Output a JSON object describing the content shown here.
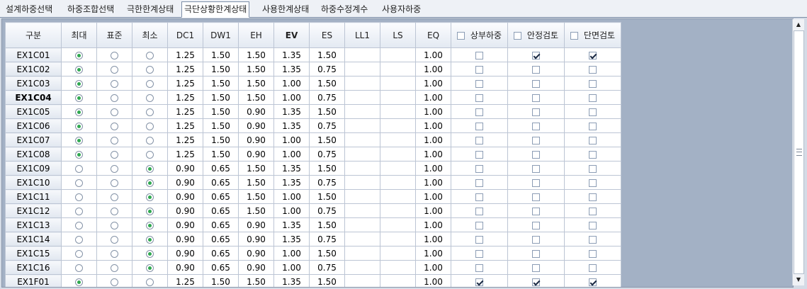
{
  "tabs": [
    "설계하중선택",
    "하중조합선택",
    "극한한계상태",
    "극단상황한계상태",
    "사용한계상태",
    "하중수정계수",
    "사용자하중"
  ],
  "active_tab": 3,
  "headers": {
    "gubun": "구분",
    "max": "최대",
    "std": "표준",
    "min": "최소",
    "dc1": "DC1",
    "dw1": "DW1",
    "eh": "EH",
    "ev": "EV",
    "es": "ES",
    "ll1": "LL1",
    "ls": "LS",
    "eq": "EQ",
    "upper": "상부하중",
    "stability": "안정검토",
    "section": "단면검토"
  },
  "rows": [
    {
      "name": "EX1C01",
      "sel": "max",
      "dc1": "1.25",
      "dw1": "1.50",
      "eh": "1.50",
      "ev": "1.35",
      "es": "1.50",
      "ll1": "",
      "ls": "",
      "eq": "1.00",
      "upper": false,
      "stability": true,
      "section": true
    },
    {
      "name": "EX1C02",
      "sel": "max",
      "dc1": "1.25",
      "dw1": "1.50",
      "eh": "1.50",
      "ev": "1.35",
      "es": "0.75",
      "ll1": "",
      "ls": "",
      "eq": "1.00",
      "upper": false,
      "stability": false,
      "section": false
    },
    {
      "name": "EX1C03",
      "sel": "max",
      "dc1": "1.25",
      "dw1": "1.50",
      "eh": "1.50",
      "ev": "1.00",
      "es": "1.50",
      "ll1": "",
      "ls": "",
      "eq": "1.00",
      "upper": false,
      "stability": false,
      "section": false
    },
    {
      "name": "EX1C04",
      "sel": "max",
      "dc1": "1.25",
      "dw1": "1.50",
      "eh": "1.50",
      "ev": "1.00",
      "es": "0.75",
      "ll1": "",
      "ls": "",
      "eq": "1.00",
      "upper": false,
      "stability": false,
      "section": false,
      "bold": true
    },
    {
      "name": "EX1C05",
      "sel": "max",
      "dc1": "1.25",
      "dw1": "1.50",
      "eh": "0.90",
      "ev": "1.35",
      "es": "1.50",
      "ll1": "",
      "ls": "",
      "eq": "1.00",
      "upper": false,
      "stability": false,
      "section": false
    },
    {
      "name": "EX1C06",
      "sel": "max",
      "dc1": "1.25",
      "dw1": "1.50",
      "eh": "0.90",
      "ev": "1.35",
      "es": "0.75",
      "ll1": "",
      "ls": "",
      "eq": "1.00",
      "upper": false,
      "stability": false,
      "section": false
    },
    {
      "name": "EX1C07",
      "sel": "max",
      "dc1": "1.25",
      "dw1": "1.50",
      "eh": "0.90",
      "ev": "1.00",
      "es": "1.50",
      "ll1": "",
      "ls": "",
      "eq": "1.00",
      "upper": false,
      "stability": false,
      "section": false
    },
    {
      "name": "EX1C08",
      "sel": "max",
      "dc1": "1.25",
      "dw1": "1.50",
      "eh": "0.90",
      "ev": "1.00",
      "es": "0.75",
      "ll1": "",
      "ls": "",
      "eq": "1.00",
      "upper": false,
      "stability": false,
      "section": false
    },
    {
      "name": "EX1C09",
      "sel": "min",
      "dc1": "0.90",
      "dw1": "0.65",
      "eh": "1.50",
      "ev": "1.35",
      "es": "1.50",
      "ll1": "",
      "ls": "",
      "eq": "1.00",
      "upper": false,
      "stability": false,
      "section": false
    },
    {
      "name": "EX1C10",
      "sel": "min",
      "dc1": "0.90",
      "dw1": "0.65",
      "eh": "1.50",
      "ev": "1.35",
      "es": "0.75",
      "ll1": "",
      "ls": "",
      "eq": "1.00",
      "upper": false,
      "stability": false,
      "section": false
    },
    {
      "name": "EX1C11",
      "sel": "min",
      "dc1": "0.90",
      "dw1": "0.65",
      "eh": "1.50",
      "ev": "1.00",
      "es": "1.50",
      "ll1": "",
      "ls": "",
      "eq": "1.00",
      "upper": false,
      "stability": false,
      "section": false
    },
    {
      "name": "EX1C12",
      "sel": "min",
      "dc1": "0.90",
      "dw1": "0.65",
      "eh": "1.50",
      "ev": "1.00",
      "es": "0.75",
      "ll1": "",
      "ls": "",
      "eq": "1.00",
      "upper": false,
      "stability": false,
      "section": false
    },
    {
      "name": "EX1C13",
      "sel": "min",
      "dc1": "0.90",
      "dw1": "0.65",
      "eh": "0.90",
      "ev": "1.35",
      "es": "1.50",
      "ll1": "",
      "ls": "",
      "eq": "1.00",
      "upper": false,
      "stability": false,
      "section": false
    },
    {
      "name": "EX1C14",
      "sel": "min",
      "dc1": "0.90",
      "dw1": "0.65",
      "eh": "0.90",
      "ev": "1.35",
      "es": "0.75",
      "ll1": "",
      "ls": "",
      "eq": "1.00",
      "upper": false,
      "stability": false,
      "section": false
    },
    {
      "name": "EX1C15",
      "sel": "min",
      "dc1": "0.90",
      "dw1": "0.65",
      "eh": "0.90",
      "ev": "1.00",
      "es": "1.50",
      "ll1": "",
      "ls": "",
      "eq": "1.00",
      "upper": false,
      "stability": false,
      "section": false
    },
    {
      "name": "EX1C16",
      "sel": "min",
      "dc1": "0.90",
      "dw1": "0.65",
      "eh": "0.90",
      "ev": "1.00",
      "es": "0.75",
      "ll1": "",
      "ls": "",
      "eq": "1.00",
      "upper": false,
      "stability": false,
      "section": false
    },
    {
      "name": "EX1F01",
      "sel": "max",
      "dc1": "1.25",
      "dw1": "1.50",
      "eh": "1.50",
      "ev": "1.35",
      "es": "1.50",
      "ll1": "",
      "ls": "",
      "eq": "1.00",
      "upper": true,
      "stability": true,
      "section": true
    }
  ]
}
